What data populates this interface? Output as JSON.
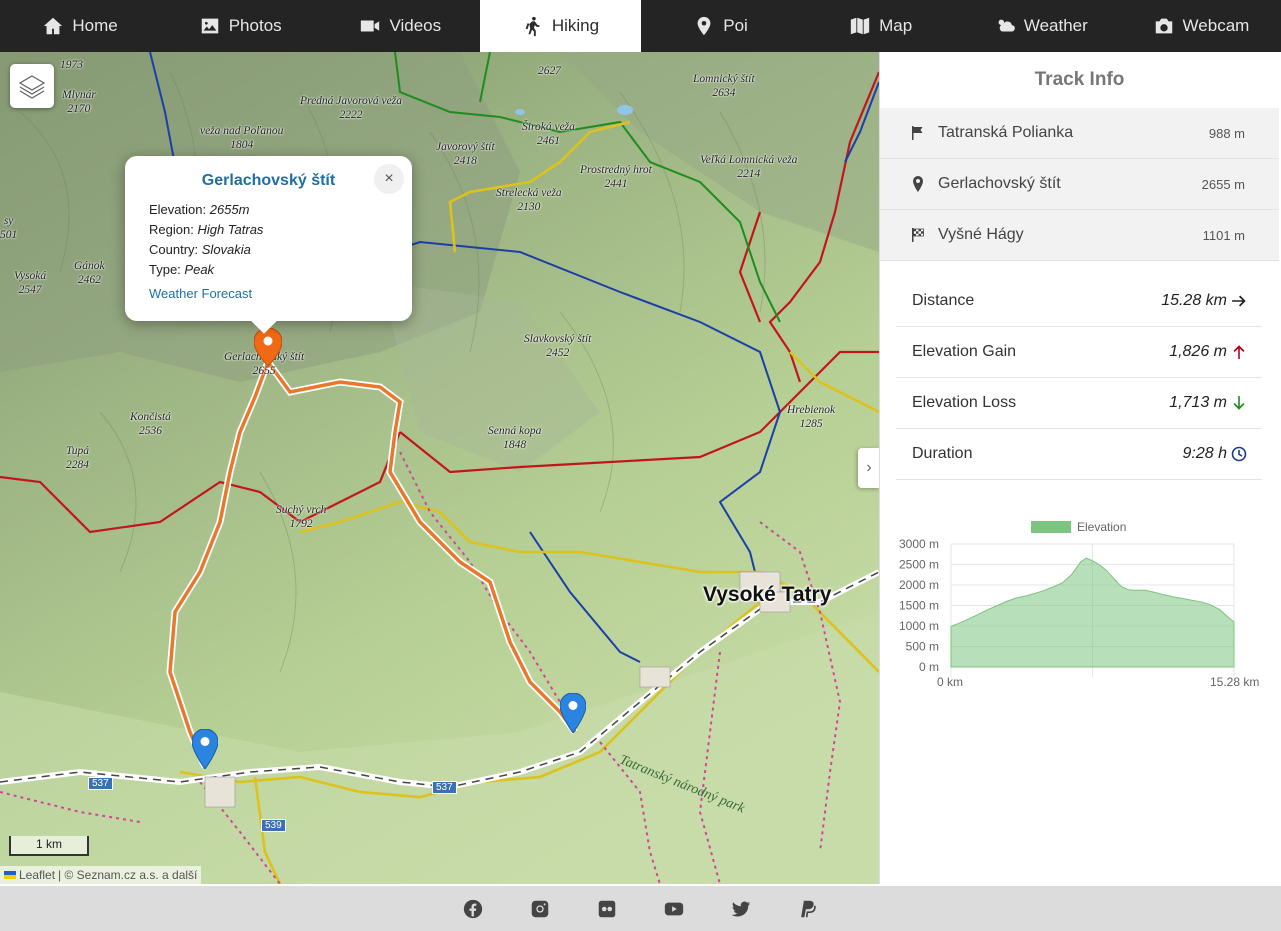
{
  "nav": {
    "items": [
      {
        "label": "Home",
        "icon": "home-icon"
      },
      {
        "label": "Photos",
        "icon": "photo-icon"
      },
      {
        "label": "Videos",
        "icon": "video-icon"
      },
      {
        "label": "Hiking",
        "icon": "hiking-icon",
        "active": true
      },
      {
        "label": "Poi",
        "icon": "map-pin-icon"
      },
      {
        "label": "Map",
        "icon": "map-icon"
      },
      {
        "label": "Weather",
        "icon": "weather-icon"
      },
      {
        "label": "Webcam",
        "icon": "camera-icon"
      }
    ]
  },
  "map": {
    "peaks": [
      {
        "name": "",
        "elev": "1973"
      },
      {
        "name": "Mlynár",
        "elev": "2170"
      },
      {
        "name": "Predná Javorová veža",
        "elev": "2222"
      },
      {
        "name": "veža nad Poľanou",
        "elev": "1804"
      },
      {
        "name": "",
        "elev": "2627"
      },
      {
        "name": "Lomnický štít",
        "elev": "2634"
      },
      {
        "name": "Široká veža",
        "elev": "2461"
      },
      {
        "name": "Javorový štít",
        "elev": "2418"
      },
      {
        "name": "Prostredný hrot",
        "elev": "2441"
      },
      {
        "name": "Veľká Lomnická veža",
        "elev": "2214"
      },
      {
        "name": "Strelecká veža",
        "elev": "2130"
      },
      {
        "name": "sy",
        "elev": "501"
      },
      {
        "name": "Gánok",
        "elev": "2462"
      },
      {
        "name": "Vysoká",
        "elev": "2547"
      },
      {
        "name": "Slavkovský štít",
        "elev": "2452"
      },
      {
        "name": "Gerlachovský štít",
        "elev": "2655"
      },
      {
        "name": "Hrebienok",
        "elev": "1285"
      },
      {
        "name": "Končistá",
        "elev": "2536"
      },
      {
        "name": "Senná kopa",
        "elev": "1848"
      },
      {
        "name": "Tupá",
        "elev": "2284"
      },
      {
        "name": "Suchý vrch",
        "elev": "1792"
      }
    ],
    "town": "Vysoké Tatry",
    "park": "Tatranský národný park",
    "roads": [
      "537",
      "537",
      "539"
    ],
    "scale_label": "1 km",
    "attribution_leaflet": "Leaflet",
    "attribution_rest": "| © Seznam.cz a.s. a další",
    "popup": {
      "title": "Gerlachovský štít",
      "rows": [
        {
          "label": "Elevation:",
          "value": "2655m"
        },
        {
          "label": "Region:",
          "value": "High Tatras"
        },
        {
          "label": "Country:",
          "value": "Slovakia"
        },
        {
          "label": "Type:",
          "value": "Peak"
        }
      ],
      "link": "Weather Forecast",
      "close": "×"
    }
  },
  "panel": {
    "title": "Track Info",
    "waypoints": [
      {
        "name": "Tatranská Polianka",
        "elev": "988 m",
        "icon": "flag-icon"
      },
      {
        "name": "Gerlachovský štít",
        "elev": "2655 m",
        "icon": "map-pin-icon"
      },
      {
        "name": "Vyšné Hágy",
        "elev": "1101 m",
        "icon": "finish-flag-icon"
      }
    ],
    "stats": [
      {
        "label": "Distance",
        "value": "15.28 km",
        "icon": "arrow-right-icon",
        "color": "#222222"
      },
      {
        "label": "Elevation Gain",
        "value": "1,826 m",
        "icon": "arrow-up-icon",
        "color": "#b3001b"
      },
      {
        "label": "Elevation Loss",
        "value": "1,713 m",
        "icon": "arrow-down-icon",
        "color": "#1e8c1e"
      },
      {
        "label": "Duration",
        "value": "9:28 h",
        "icon": "clock-icon",
        "color": "#1a3a8a"
      }
    ]
  },
  "chart_data": {
    "type": "area",
    "series": [
      {
        "name": "Elevation",
        "color": "#7cc47f"
      }
    ],
    "x": [
      0,
      0.5,
      1.0,
      1.5,
      2.0,
      2.5,
      3.0,
      3.5,
      4.0,
      4.5,
      5.0,
      5.5,
      6.0,
      6.5,
      7.0,
      7.3,
      7.6,
      8.0,
      8.4,
      8.8,
      9.2,
      9.6,
      10.0,
      10.5,
      11.0,
      11.5,
      12.0,
      12.5,
      13.0,
      13.5,
      14.0,
      14.5,
      15.0,
      15.28
    ],
    "y": [
      988,
      1080,
      1180,
      1290,
      1400,
      1500,
      1600,
      1680,
      1730,
      1790,
      1860,
      1950,
      2050,
      2250,
      2560,
      2655,
      2600,
      2500,
      2350,
      2150,
      1960,
      1880,
      1870,
      1870,
      1820,
      1760,
      1710,
      1670,
      1630,
      1590,
      1520,
      1400,
      1200,
      1101
    ],
    "xlabel_min": "0 km",
    "xlabel_max": "15.28 km",
    "ylim": [
      0,
      3000
    ],
    "yticks": [
      "0 m",
      "500 m",
      "1000 m",
      "1500 m",
      "2000 m",
      "2500 m",
      "3000 m"
    ],
    "legend": "top",
    "grid": true
  },
  "footer": {
    "icons": [
      "facebook-icon",
      "instagram-icon",
      "flickr-icon",
      "youtube-icon",
      "twitter-icon",
      "paypal-icon"
    ]
  }
}
